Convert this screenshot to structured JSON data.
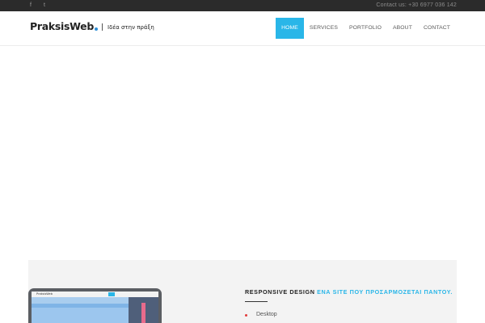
{
  "topbar": {
    "social": [
      {
        "icon": "facebook-icon",
        "glyph": "f"
      },
      {
        "icon": "twitter-icon",
        "glyph": "t"
      }
    ],
    "contact": "Contact us: +30 6977 036 142"
  },
  "header": {
    "logo_text": "PraksisWeb",
    "logo_tagline": "Ιδέα στην πράξη",
    "nav": [
      {
        "label": "HOME",
        "active": true
      },
      {
        "label": "SERVICES",
        "active": false
      },
      {
        "label": "PORTFOLIO",
        "active": false
      },
      {
        "label": "ABOUT",
        "active": false
      },
      {
        "label": "CONTACT",
        "active": false
      }
    ]
  },
  "feature": {
    "title_dark": "RESPONSIVE DESIGN",
    "title_blue": "ΕΝΑ SITE ΠΟΥ ΠΡΟΣΑΡΜΟΖΕΤΑΙ ΠΑΝΤΟΥ.",
    "items": [
      "Desktop"
    ],
    "mockup_logo": "PraksisWeb"
  },
  "colors": {
    "accent": "#29b6e8",
    "topbar_bg": "#2b2b2b",
    "bullet": "#e23b3b"
  }
}
